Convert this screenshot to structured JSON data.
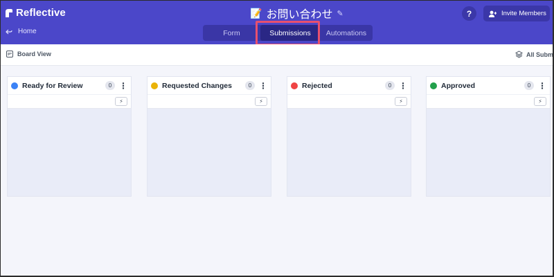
{
  "app": {
    "brand": "Reflective",
    "home_label": "Home",
    "form_title": "お問い合わせ",
    "help_label": "?",
    "invite_label": "Invite Members"
  },
  "tabs": [
    {
      "label": "Form",
      "active": false
    },
    {
      "label": "Submissions",
      "active": true
    },
    {
      "label": "Automations",
      "active": false
    }
  ],
  "toolbar": {
    "board_view_label": "Board View",
    "all_submissions_label": "All Submi"
  },
  "columns": [
    {
      "label": "Ready for Review",
      "count": "0",
      "color": "#3b82f6"
    },
    {
      "label": "Requested Changes",
      "count": "0",
      "color": "#eab308"
    },
    {
      "label": "Rejected",
      "count": "0",
      "color": "#ef4444"
    },
    {
      "label": "Approved",
      "count": "0",
      "color": "#22a04b"
    }
  ],
  "colors": {
    "header_bg": "#4b47c9",
    "highlight": "#e8506e"
  },
  "icons": {
    "brand": "reflective-logo-icon",
    "back": "back-arrow-icon",
    "memo": "memo-icon",
    "edit": "pencil-icon",
    "invite": "add-user-icon",
    "board": "board-icon",
    "layers": "layers-icon",
    "more": "kebab-icon",
    "automation": "bolt-icon"
  }
}
